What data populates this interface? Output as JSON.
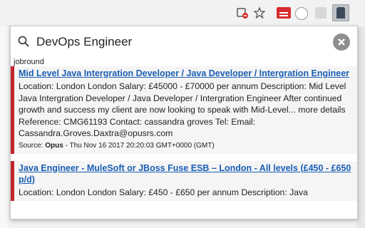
{
  "toolbar": {
    "icons": [
      "block-page-icon",
      "bookmark-star-icon",
      "red-extension-icon",
      "circle-extension-icon",
      "gray-extension-icon",
      "job-extension-icon"
    ]
  },
  "popup": {
    "search": {
      "value": "DevOps Engineer",
      "placeholder": ""
    },
    "source_label": "jobround",
    "jobs": [
      {
        "title": "Mid Level Java Intergration Developer / Java Developer / Intergration Engineer",
        "description": "Location: London London Salary: £45000 - £70000 per annum Description: Mid Level Java Intergration Developer / Java Developer / Intergration Engineer After continued growth and success my client are now looking to speak with Mid-Level... more details Reference: CMG61193 Contact: cassandra groves Tel: Email: Cassandra.Groves.Daxtra@opusrs.com",
        "source_prefix": "Source: ",
        "source_name": "Opus",
        "source_date": " - Thu Nov 16 2017 20:20:03 GMT+0000 (GMT)"
      },
      {
        "title": "Java Engineer - MuleSoft or JBoss Fuse ESB – London - All levels (£450 - £650 p/d)",
        "description": "Location: London London Salary: £450 - £650 per annum Description: Java",
        "source_prefix": "",
        "source_name": "",
        "source_date": ""
      }
    ]
  },
  "colors": {
    "accent_red": "#c1272d",
    "link_blue": "#1a5fb4"
  }
}
